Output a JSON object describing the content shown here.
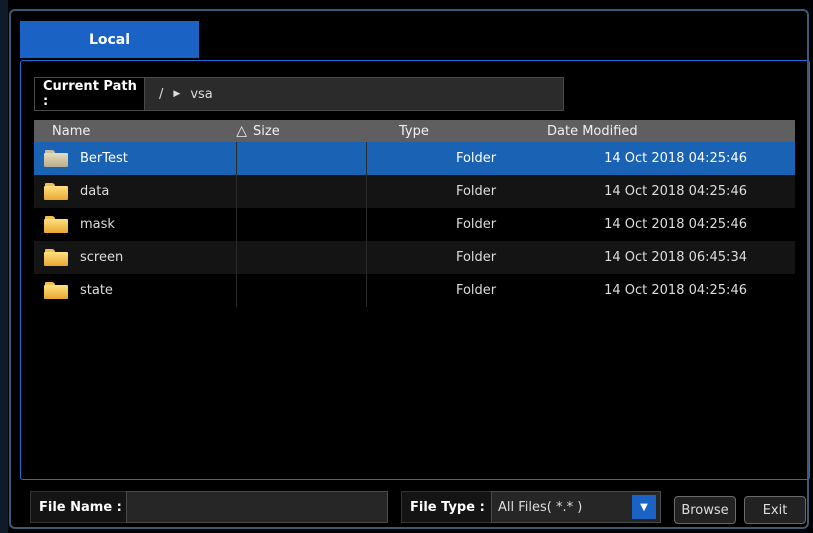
{
  "tabs": [
    {
      "label": "Local",
      "active": true
    }
  ],
  "path": {
    "label": "Current Path :",
    "root": "/",
    "segment": "vsa"
  },
  "table": {
    "columns": {
      "name": "Name",
      "size": "Size",
      "type": "Type",
      "date": "Date Modified"
    },
    "sort_icon": "triangle-up-icon",
    "rows": [
      {
        "name": "BerTest",
        "size": "",
        "type": "Folder",
        "date": "14 Oct 2018 04:25:46",
        "selected": true
      },
      {
        "name": "data",
        "size": "",
        "type": "Folder",
        "date": "14 Oct 2018 04:25:46"
      },
      {
        "name": "mask",
        "size": "",
        "type": "Folder",
        "date": "14 Oct 2018 04:25:46"
      },
      {
        "name": "screen",
        "size": "",
        "type": "Folder",
        "date": "14 Oct 2018 06:45:34"
      },
      {
        "name": "state",
        "size": "",
        "type": "Folder",
        "date": "14 Oct 2018 04:25:46"
      }
    ]
  },
  "file_name": {
    "label": "File Name :",
    "value": ""
  },
  "file_type": {
    "label": "File Type :",
    "value": "All Files( *.* )"
  },
  "buttons": {
    "browse": "Browse",
    "exit": "Exit"
  },
  "colors": {
    "accent": "#1a62c4",
    "selected_row": "#1a62b4",
    "header": "#5f5f5f"
  }
}
